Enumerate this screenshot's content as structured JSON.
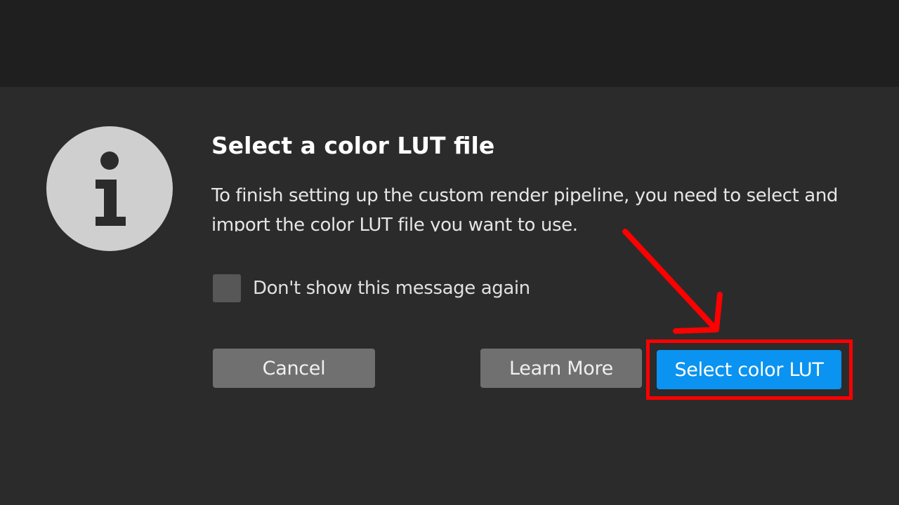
{
  "dialog": {
    "title": "Select a color LUT file",
    "message": "To finish setting up the custom render pipeline, you need to select and import the color LUT file you want to use.",
    "checkbox_label": "Don't show this message again",
    "checkbox_checked": false,
    "icon": "info-icon"
  },
  "buttons": {
    "cancel": "Cancel",
    "learn_more": "Learn More",
    "select_lut": "Select color LUT"
  },
  "annotation": {
    "highlight_target": "select-color-lut-button",
    "highlight_color": "#ff0000",
    "arrow_color": "#ff0000"
  },
  "colors": {
    "background": "#2b2b2b",
    "top_bar": "#1f1f1f",
    "primary_button": "#0a93f0",
    "secondary_button": "#707070",
    "icon_circle": "#cfcfcf"
  }
}
